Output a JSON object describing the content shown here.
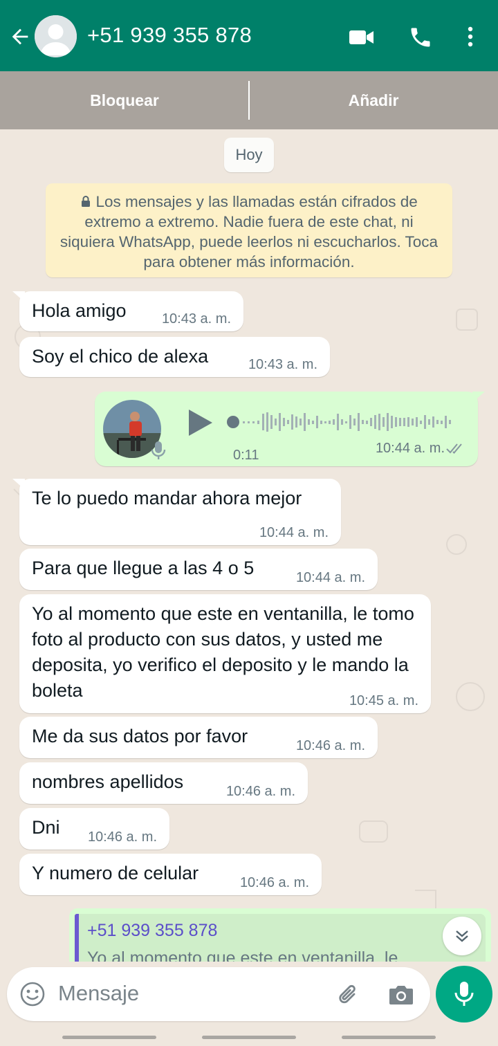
{
  "header": {
    "title": "+51 939 355 878",
    "icons": [
      "back-arrow-icon",
      "avatar-placeholder",
      "video-call-icon",
      "phone-icon",
      "more-vert-icon"
    ],
    "color": "#008069"
  },
  "actions": {
    "block_label": "Bloquear",
    "add_label": "Añadir"
  },
  "chat": {
    "date_chip": "Hoy",
    "encryption_notice": "Los mensajes y las llamadas están cifrados de extremo a extremo. Nadie fuera de este chat, ni siquiera WhatsApp, puede leerlos ni escucharlos. Toca para obtener más información.",
    "messages": [
      {
        "text": "Hola amigo",
        "time": "10:43 a. m."
      },
      {
        "text": "Soy el chico de alexa",
        "time": "10:43 a. m."
      },
      {
        "voice_duration": "0:11",
        "time": "10:44 a. m.",
        "status": "read"
      },
      {
        "text": "Te lo puedo mandar ahora mejor",
        "time": "10:44 a. m."
      },
      {
        "text": "Para que llegue a las 4 o 5",
        "time": "10:44 a. m."
      },
      {
        "text": "Yo al momento que este en ventanilla, le tomo foto al producto con sus datos, y usted me deposita, yo verifico el deposito y le mando la boleta",
        "time": "10:45 a. m."
      },
      {
        "text": "Me da sus datos por favor",
        "time": "10:46 a. m."
      },
      {
        "text": "nombres apellidos",
        "time": "10:46 a. m."
      },
      {
        "text": "Dni",
        "time": "10:46 a. m."
      },
      {
        "text": "Y numero de celular",
        "time": "10:46 a. m."
      }
    ],
    "reply": {
      "quoted_name": "+51 939 355 878",
      "quoted_text": "Yo al momento que este en ventanilla, le"
    }
  },
  "composer": {
    "placeholder": "Mensaje"
  }
}
